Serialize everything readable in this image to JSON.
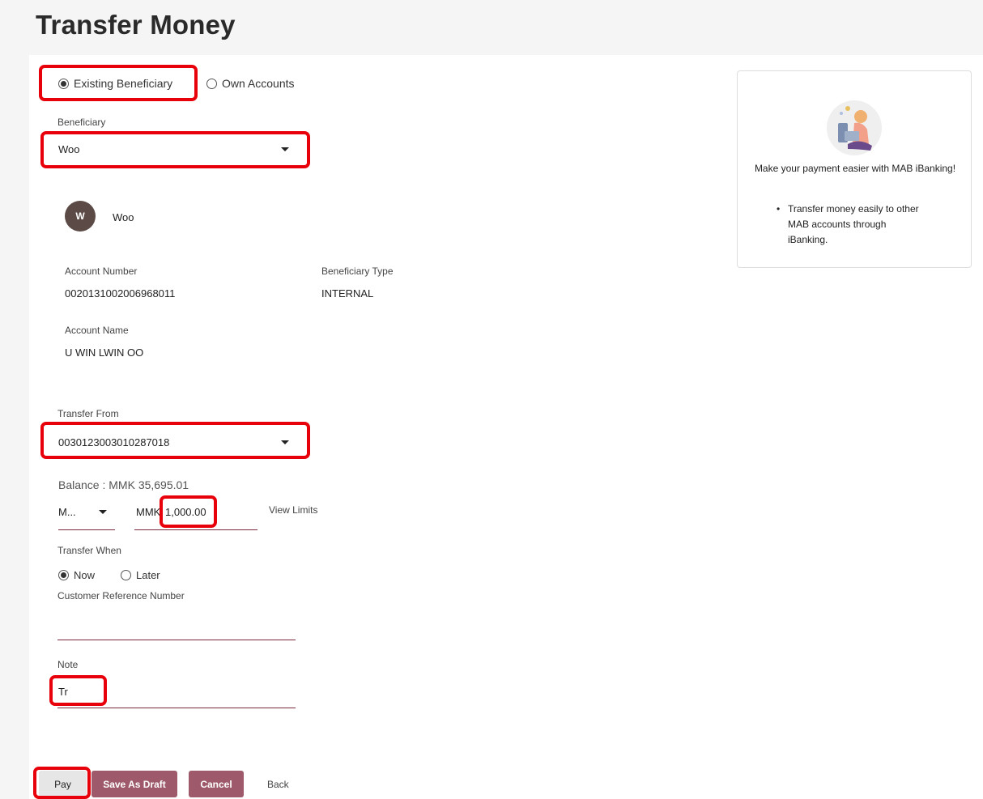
{
  "page": {
    "title": "Transfer Money"
  },
  "mode": {
    "existing_label": "Existing Beneficiary",
    "own_label": "Own Accounts",
    "selected": "existing"
  },
  "beneficiary": {
    "label": "Beneficiary",
    "selected": "Woo",
    "avatar_initial": "W",
    "name": "Woo",
    "account_number_label": "Account Number",
    "account_number": "0020131002006968011",
    "type_label": "Beneficiary Type",
    "type": "INTERNAL",
    "account_name_label": "Account Name",
    "account_name": "U WIN LWIN OO"
  },
  "transfer_from": {
    "label": "Transfer From",
    "selected": "0030123003010287018",
    "balance": "Balance : MMK 35,695.01"
  },
  "amount": {
    "currency_select": "M...",
    "currency_prefix": "MMK",
    "value": "1,000.00",
    "view_limits": "View Limits"
  },
  "transfer_when": {
    "label": "Transfer When",
    "now_label": "Now",
    "later_label": "Later",
    "selected": "now"
  },
  "reference": {
    "label": "Customer Reference Number",
    "value": ""
  },
  "note": {
    "label": "Note",
    "value": "Tr"
  },
  "buttons": {
    "pay": "Pay",
    "save_draft": "Save As Draft",
    "cancel": "Cancel",
    "back": "Back"
  },
  "promo": {
    "title": "Make your payment easier with MAB iBanking!",
    "bullet": "Transfer money easily to other MAB accounts through iBanking."
  },
  "colors": {
    "accent": "#9e5a6a",
    "highlight": "#e8000b",
    "underline": "#7a2a3a"
  }
}
